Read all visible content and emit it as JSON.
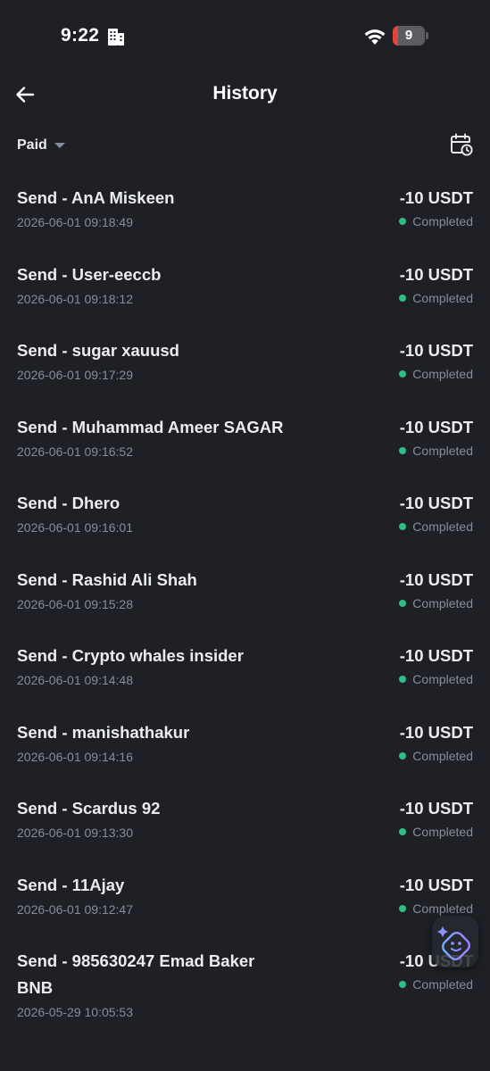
{
  "status_bar": {
    "time": "9:22",
    "battery_level": "9",
    "time_icon": "building-icon",
    "wifi_icon": "wifi-icon"
  },
  "header": {
    "title": "History",
    "back_icon": "arrow-left-icon"
  },
  "filter": {
    "label": "Paid",
    "dropdown_icon": "caret-down-icon",
    "calendar_icon": "calendar-clock-icon"
  },
  "colors": {
    "background": "#1e2026",
    "completed_dot": "#2ebd85",
    "primary_text": "#eaecef",
    "secondary_text": "#848e9c"
  },
  "transactions": [
    {
      "title": "Send - AnA Miskeen",
      "time": "2026-06-01 09:18:49",
      "amount": "-10 USDT",
      "status": "Completed"
    },
    {
      "title": "Send - User-eeccb",
      "time": "2026-06-01 09:18:12",
      "amount": "-10 USDT",
      "status": "Completed"
    },
    {
      "title": "Send - sugar xauusd",
      "time": "2026-06-01 09:17:29",
      "amount": "-10 USDT",
      "status": "Completed"
    },
    {
      "title": "Send - Muhammad Ameer SAGAR",
      "time": "2026-06-01 09:16:52",
      "amount": "-10 USDT",
      "status": "Completed"
    },
    {
      "title": "Send - Dhero",
      "time": "2026-06-01 09:16:01",
      "amount": "-10 USDT",
      "status": "Completed"
    },
    {
      "title": "Send - Rashid Ali Shah",
      "time": "2026-06-01 09:15:28",
      "amount": "-10 USDT",
      "status": "Completed"
    },
    {
      "title": "Send - Crypto whales insider",
      "time": "2026-06-01 09:14:48",
      "amount": "-10 USDT",
      "status": "Completed"
    },
    {
      "title": "Send - manishathakur",
      "time": "2026-06-01 09:14:16",
      "amount": "-10 USDT",
      "status": "Completed"
    },
    {
      "title": "Send - Scardus 92",
      "time": "2026-06-01 09:13:30",
      "amount": "-10 USDT",
      "status": "Completed"
    },
    {
      "title": "Send - 11Ajay",
      "time": "2026-06-01 09:12:47",
      "amount": "-10 USDT",
      "status": "Completed"
    },
    {
      "title": "Send - 985630247 Emad Baker BNB",
      "time": "2026-05-29 10:05:53",
      "amount": "-10 USDT",
      "status": "Completed"
    }
  ],
  "assistant": {
    "icon": "ai-assistant-icon"
  }
}
